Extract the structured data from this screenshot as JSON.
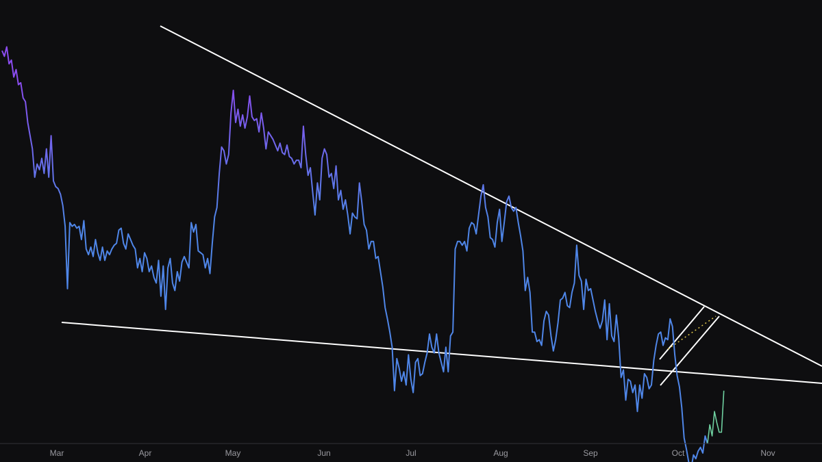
{
  "chart_data": {
    "type": "line",
    "title": "",
    "xlabel": "",
    "ylabel": "",
    "x_ticks": [
      "Mar",
      "Apr",
      "May",
      "Jun",
      "Jul",
      "Aug",
      "Sep",
      "Oct",
      "Nov"
    ],
    "grid": false,
    "legend": "none",
    "ylim": [
      0,
      100
    ],
    "series": [
      {
        "values": [
          100,
          97,
          102,
          93,
          95,
          86,
          90,
          82,
          83,
          75,
          73,
          62,
          55,
          48,
          33,
          40,
          37,
          43,
          35,
          48,
          33,
          55,
          31,
          28,
          27,
          24,
          18,
          7,
          -26,
          9,
          7,
          8,
          6,
          7,
          0,
          10,
          -5,
          -8,
          -4,
          -9,
          0,
          -7,
          -11,
          -4,
          -11,
          -6,
          -8,
          -5,
          -3,
          -2,
          5,
          6,
          -2,
          -5,
          3,
          0,
          -3,
          -5,
          -15,
          -10,
          -17,
          -7,
          -10,
          -17,
          -14,
          -20,
          -23,
          -11,
          -30,
          -14,
          -37,
          -15,
          -10,
          -23,
          -27,
          -17,
          -22,
          -12,
          -9,
          -12,
          -15,
          9,
          4,
          8,
          -6,
          -7,
          -8,
          -15,
          -10,
          -18,
          -2,
          12,
          17,
          35,
          49,
          47,
          40,
          45,
          67,
          79,
          62,
          69,
          60,
          66,
          59,
          65,
          76,
          65,
          63,
          64,
          57,
          67,
          59,
          48,
          57,
          55,
          53,
          50,
          47,
          51,
          46,
          45,
          50,
          44,
          43,
          40,
          42,
          42,
          38,
          60,
          45,
          34,
          38,
          25,
          13,
          30,
          21,
          43,
          48,
          45,
          33,
          35,
          27,
          39,
          21,
          26,
          16,
          21,
          13,
          3,
          14,
          12,
          11,
          30,
          20,
          8,
          5,
          -5,
          -1,
          -1,
          -10,
          -9,
          -17,
          -25,
          -36,
          -42,
          -49,
          -57,
          -80,
          -63,
          -68,
          -75,
          -70,
          -77,
          -61,
          -74,
          -81,
          -65,
          -63,
          -72,
          -71,
          -65,
          -60,
          -50,
          -57,
          -60,
          -50,
          -60,
          -65,
          -70,
          -57,
          -70,
          -51,
          -49,
          -5,
          -1,
          -1,
          -3,
          -1,
          -6,
          6,
          9,
          8,
          3,
          13,
          23,
          29,
          17,
          12,
          1,
          0,
          -4,
          9,
          16,
          -1,
          9,
          20,
          23,
          17,
          15,
          17,
          9,
          2,
          -6,
          -27,
          -20,
          -28,
          -49,
          -49,
          -54,
          -53,
          -56,
          -43,
          -38,
          -40,
          -51,
          -59,
          -53,
          -44,
          -32,
          -31,
          -28,
          -35,
          -36,
          -28,
          -23,
          -3,
          -19,
          -22,
          -37,
          -21,
          -27,
          -26,
          -32,
          -38,
          -43,
          -47,
          -43,
          -32,
          -53,
          -34,
          -51,
          -54,
          -40,
          -52,
          -73,
          -69,
          -85,
          -74,
          -75,
          -81,
          -77,
          -91,
          -77,
          -84,
          -71,
          -73,
          -79,
          -77,
          -64,
          -56,
          -50,
          -49,
          -56,
          -52,
          -53,
          -42,
          -46,
          -61,
          -72,
          -78,
          -89,
          -105,
          -111,
          -118,
          -121,
          -114,
          -116,
          -112,
          -110,
          -113,
          -104,
          -108,
          -98,
          -104,
          -91,
          -97,
          -102,
          -102,
          -80
        ]
      }
    ],
    "gradient_colors": [
      "#8b4cf0",
      "#4f86e8"
    ],
    "line_color_end": "#6fd0a0",
    "trendline_color": "#ffffff",
    "midline_color": "#e3c94a",
    "background_color": "#0e0e10",
    "axis_color": "#333338",
    "tick_color": "#9a9aa0"
  }
}
